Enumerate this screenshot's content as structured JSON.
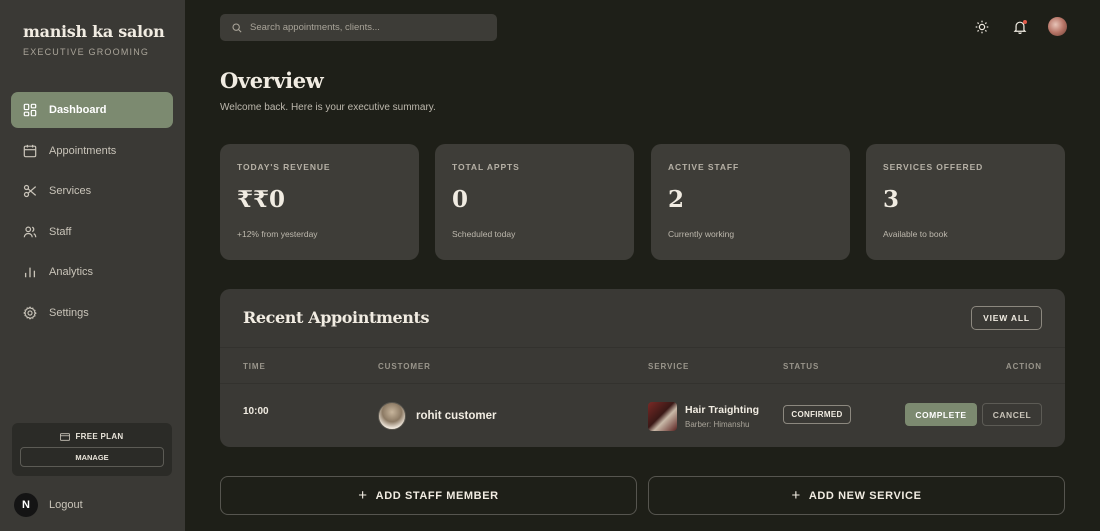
{
  "brand": {
    "name": "manish ka salon",
    "tagline": "EXECUTIVE GROOMING"
  },
  "sidebar": {
    "items": [
      {
        "label": "Dashboard",
        "icon": "grid-icon",
        "active": true
      },
      {
        "label": "Appointments",
        "icon": "calendar-icon"
      },
      {
        "label": "Services",
        "icon": "scissors-icon"
      },
      {
        "label": "Staff",
        "icon": "users-icon"
      },
      {
        "label": "Analytics",
        "icon": "bar-chart-icon"
      },
      {
        "label": "Settings",
        "icon": "gear-icon"
      }
    ],
    "plan": {
      "label": "FREE PLAN",
      "manage_label": "MANAGE"
    },
    "logout": {
      "badge": "N",
      "label": "Logout"
    }
  },
  "header": {
    "search_placeholder": "Search appointments, clients...",
    "icons": [
      "sun-icon",
      "bell-icon",
      "avatar"
    ]
  },
  "overview": {
    "title": "Overview",
    "subtitle": "Welcome back. Here is your executive summary."
  },
  "stats": [
    {
      "label": "TODAY'S REVENUE",
      "value": "₹₹0",
      "note": "+12% from yesterday"
    },
    {
      "label": "TOTAL APPTS",
      "value": "0",
      "note": "Scheduled today"
    },
    {
      "label": "ACTIVE STAFF",
      "value": "2",
      "note": "Currently working"
    },
    {
      "label": "SERVICES OFFERED",
      "value": "3",
      "note": "Available to book"
    }
  ],
  "recent": {
    "title": "Recent Appointments",
    "view_all": "VIEW ALL",
    "columns": [
      "TIME",
      "CUSTOMER",
      "SERVICE",
      "STATUS",
      "ACTION"
    ],
    "rows": [
      {
        "time": "10:00",
        "customer": "rohit customer",
        "service": "Hair Traighting",
        "barber": "Barber: Himanshu",
        "status": "CONFIRMED",
        "actions": {
          "complete": "COMPLETE",
          "cancel": "CANCEL"
        }
      }
    ]
  },
  "actions": {
    "add_staff": "ADD STAFF MEMBER",
    "add_service": "ADD NEW SERVICE",
    "plus": "+"
  },
  "colors": {
    "background": "#1e1f18",
    "sidebar": "#3a3935",
    "card": "#3e3d38",
    "accent": "#7c8a70",
    "notification": "#e25a4a"
  }
}
